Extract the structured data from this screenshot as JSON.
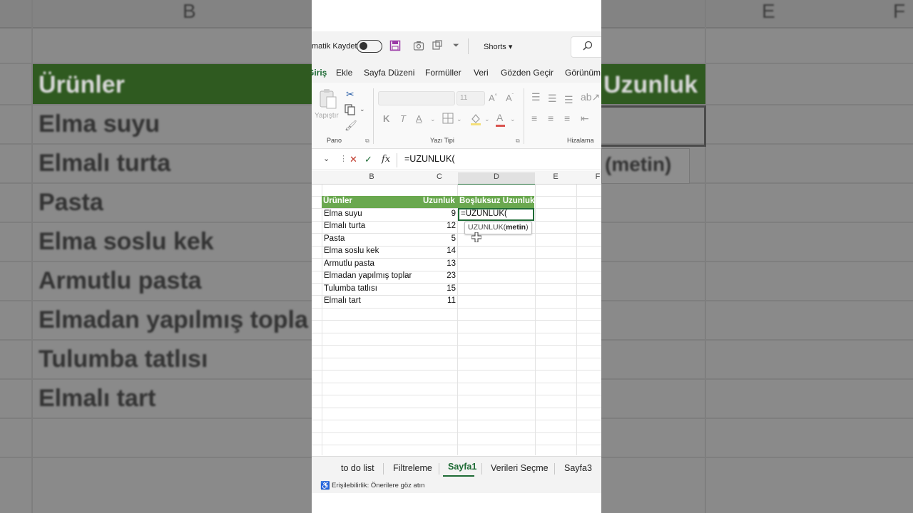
{
  "background": {
    "col_labels": [
      "B",
      "E",
      "F"
    ],
    "header_left": "Ürünler",
    "header_right": "Uzunluk",
    "rows": [
      "Elma suyu",
      "Elmalı turta",
      "Pasta",
      "Elma soslu kek",
      "Armutlu pasta",
      "Elmadan yapılmış topla",
      "Tulumba tatlısı",
      "Elmalı tart"
    ],
    "tip_text": "(metin)"
  },
  "qat": {
    "autosave_label": "matik Kaydet",
    "autosave_on": false,
    "doc_name": "Shorts ▾"
  },
  "tabs": [
    {
      "label": "Giriş",
      "active": true
    },
    {
      "label": "Ekle"
    },
    {
      "label": "Sayfa Düzeni"
    },
    {
      "label": "Formüller"
    },
    {
      "label": "Veri"
    },
    {
      "label": "Gözden Geçir"
    },
    {
      "label": "Görünüm"
    }
  ],
  "ribbon": {
    "paste_label": "Yapıştır",
    "font_size": "11",
    "group_clipboard": "Pano",
    "group_font": "Yazı Tipi",
    "group_align": "Hizalama",
    "bold": "K",
    "italic": "T"
  },
  "formula_bar": {
    "cancel": "✕",
    "enter": "✓",
    "fx": "fx",
    "content": "=UZUNLUK("
  },
  "columns": [
    "B",
    "C",
    "D",
    "E",
    "F"
  ],
  "table": {
    "headers": [
      "Ürünler",
      "Uzunluk",
      "Boşluksuz Uzunluk"
    ],
    "rows": [
      {
        "name": "Elma suyu",
        "len": "9"
      },
      {
        "name": "Elmalı turta",
        "len": "12"
      },
      {
        "name": "Pasta",
        "len": "5"
      },
      {
        "name": "Elma soslu kek",
        "len": "14"
      },
      {
        "name": "Armutlu pasta",
        "len": "13"
      },
      {
        "name": "Elmadan yapılmış toplar",
        "len": "23"
      },
      {
        "name": "Tulumba tatlısı",
        "len": "15"
      },
      {
        "name": "Elmalı tart",
        "len": "11"
      }
    ],
    "active_cell_value": "=UZUNLUK(",
    "tooltip_fn": "UZUNLUK(",
    "tooltip_arg": "metin",
    "tooltip_close": ")"
  },
  "sheet_tabs": [
    {
      "label": "to do list"
    },
    {
      "label": "Filtreleme"
    },
    {
      "label": "Sayfa1",
      "active": true
    },
    {
      "label": "Verileri Seçme"
    },
    {
      "label": "Sayfa3"
    }
  ],
  "status": {
    "accessibility": "Erişilebilirlik: Önerilere göz atın"
  },
  "colors": {
    "header_green": "#6aa84f",
    "accent": "#1e6b35"
  }
}
